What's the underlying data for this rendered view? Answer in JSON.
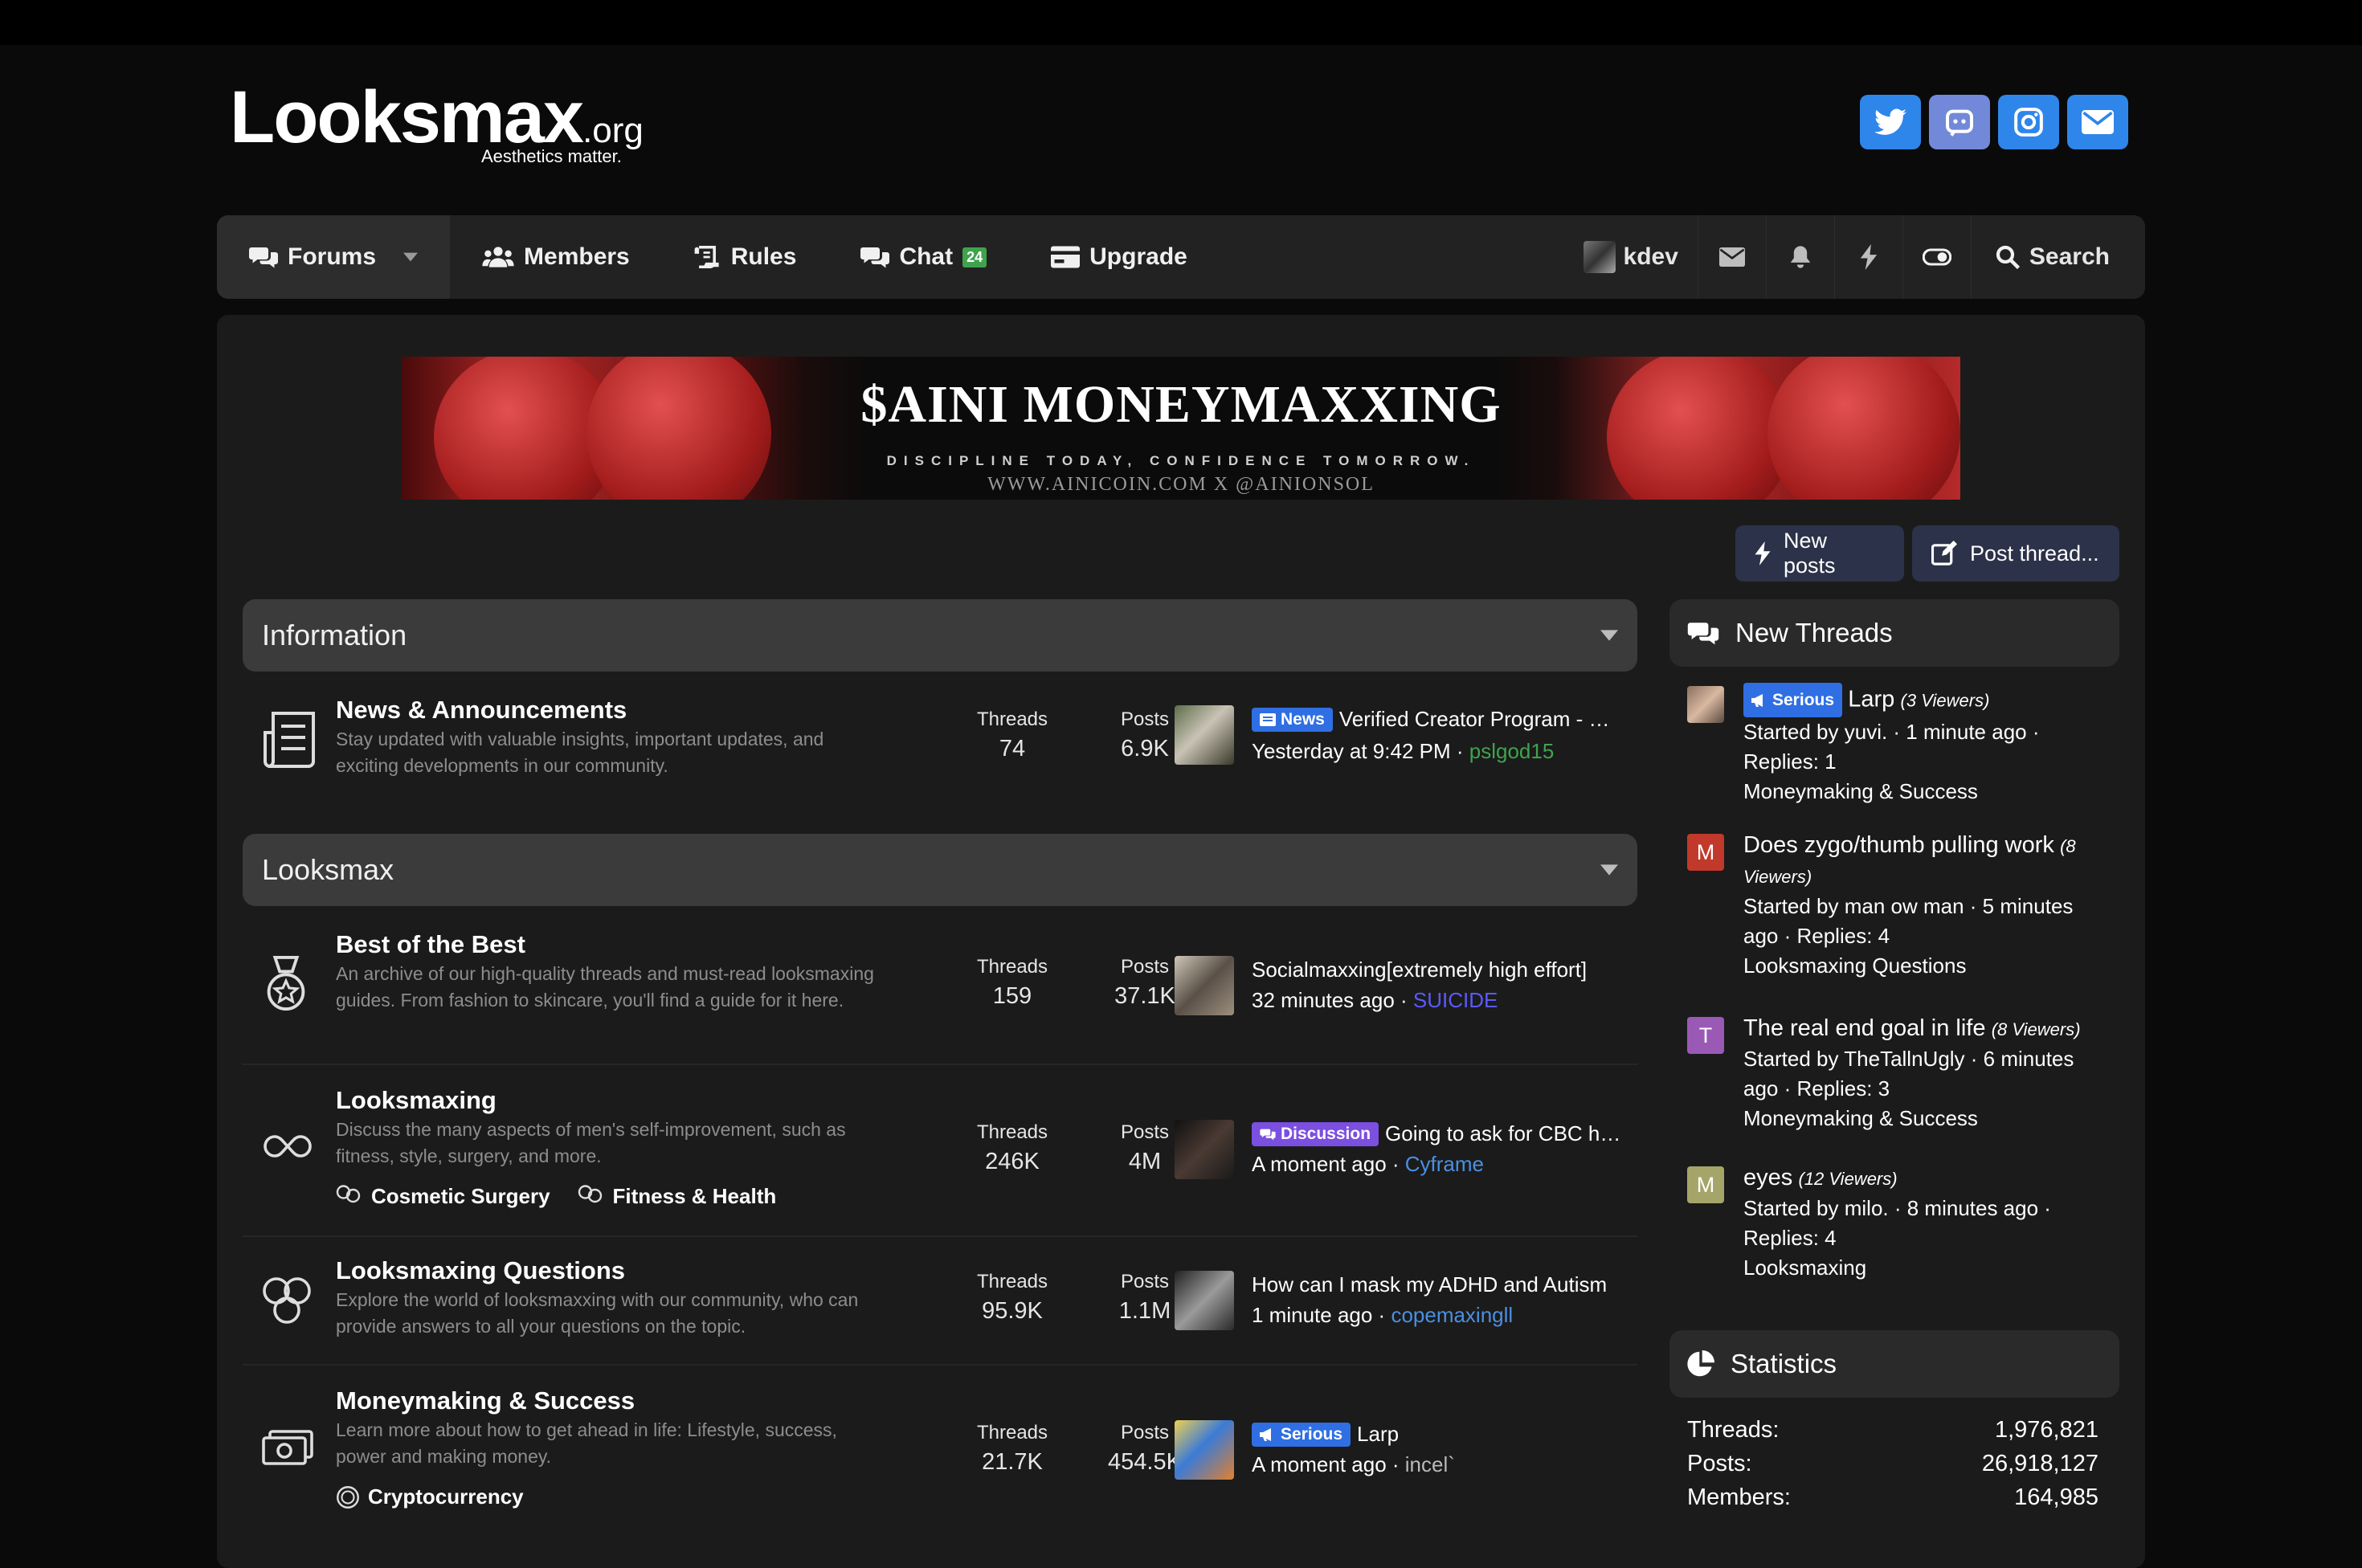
{
  "site": {
    "logo_main": "Looksmax",
    "logo_org": ".org",
    "tagline": "Aesthetics matter."
  },
  "social_icons": [
    "twitter-icon",
    "discord-icon",
    "instagram-icon",
    "mail-icon"
  ],
  "colors": {
    "accent": "#2f86ea",
    "discord": "#7289da",
    "prefix_blue": "#2f6fe3",
    "prefix_purple": "#7b4fe0",
    "chat_badge": "#3fa34d",
    "link_blue": "#4a90e2",
    "link_green": "#3fa34d"
  },
  "nav": {
    "forums": "Forums",
    "members": "Members",
    "rules": "Rules",
    "chat": "Chat",
    "chat_count": "24",
    "upgrade": "Upgrade",
    "username": "kdev",
    "search": "Search"
  },
  "banner": {
    "title": "$AINI MONEYMAXXING",
    "subtitle": "DISCIPLINE TODAY, CONFIDENCE TOMORROW.",
    "url": "WWW.AINICOIN.COM  X @AINIONSOL"
  },
  "actions": {
    "new_posts": "New posts",
    "post_thread": "Post thread..."
  },
  "labels": {
    "threads": "Threads",
    "posts": "Posts"
  },
  "categories": [
    {
      "title": "Information",
      "forums": [
        {
          "title": "News & Announcements",
          "desc": "Stay updated with valuable insights, important updates, and exciting developments in our community.",
          "threads": "74",
          "posts": "6.9K",
          "last_prefix": "News",
          "last_title": "Verified Creator Program - How to Get Verified",
          "last_time": "Yesterday at 9:42 PM",
          "last_user": "pslgod15"
        }
      ]
    },
    {
      "title": "Looksmax",
      "forums": [
        {
          "title": "Best of the Best",
          "desc": "An archive of our high-quality threads and must-read looksmaxing guides. From fashion to skincare, you'll find a guide for it here.",
          "threads": "159",
          "posts": "37.1K",
          "last_title": "Socialmaxxing[extremely high effort]",
          "last_time": "32 minutes ago",
          "last_user": "SUICIDE"
        },
        {
          "title": "Looksmaxing",
          "desc": "Discuss the many aspects of men's self-improvement, such as fitness, style, surgery, and more.",
          "subforums": [
            "Cosmetic Surgery",
            "Fitness & Health"
          ],
          "threads": "246K",
          "posts": "4M",
          "last_prefix": "Discussion",
          "last_title": "Going to ask for CBC help",
          "last_time": "A moment ago",
          "last_user": "Cyframe"
        },
        {
          "title": "Looksmaxing Questions",
          "desc": "Explore the world of looksmaxxing with our community, who can provide answers to all your questions on the topic.",
          "threads": "95.9K",
          "posts": "1.1M",
          "last_title": "How can I mask my ADHD and Autism",
          "last_time": "1 minute ago",
          "last_user": "copemaxingll"
        },
        {
          "title": "Moneymaking & Success",
          "desc": "Learn more about how to get ahead in life: Lifestyle, success, power and making money.",
          "subforums": [
            "Cryptocurrency"
          ],
          "threads": "21.7K",
          "posts": "454.5K",
          "last_prefix": "Serious",
          "last_title": "Larp",
          "last_time": "A moment ago",
          "last_user": "incel`"
        }
      ]
    }
  ],
  "sidebar": {
    "new_threads_title": "New Threads",
    "threads": [
      {
        "avatar_letter": "",
        "prefix": "Serious",
        "title": "Larp",
        "viewers": "(3 Viewers)",
        "meta": "Started by yuvi. · 1 minute ago · Replies: 1",
        "forum": "Moneymaking & Success"
      },
      {
        "avatar_letter": "M",
        "avatar_color": "#c0392b",
        "title": "Does zygo/thumb pulling work",
        "viewers": "(8 Viewers)",
        "meta": "Started by man ow man · 5 minutes ago · Replies: 4",
        "forum": "Looksmaxing Questions"
      },
      {
        "avatar_letter": "T",
        "avatar_color": "#9b59b6",
        "title": "The real end goal in life",
        "viewers": "(8 Viewers)",
        "meta": "Started by TheTallnUgly · 6 minutes ago · Replies: 3",
        "forum": "Moneymaking & Success"
      },
      {
        "avatar_letter": "M",
        "avatar_color": "#a5a56a",
        "title": "eyes",
        "viewers": "(12 Viewers)",
        "meta": "Started by milo. · 8 minutes ago · Replies: 4",
        "forum": "Looksmaxing"
      }
    ],
    "statistics_title": "Statistics",
    "stats": [
      {
        "label": "Threads:",
        "value": "1,976,821"
      },
      {
        "label": "Posts:",
        "value": "26,918,127"
      },
      {
        "label": "Members:",
        "value": "164,985"
      }
    ]
  }
}
